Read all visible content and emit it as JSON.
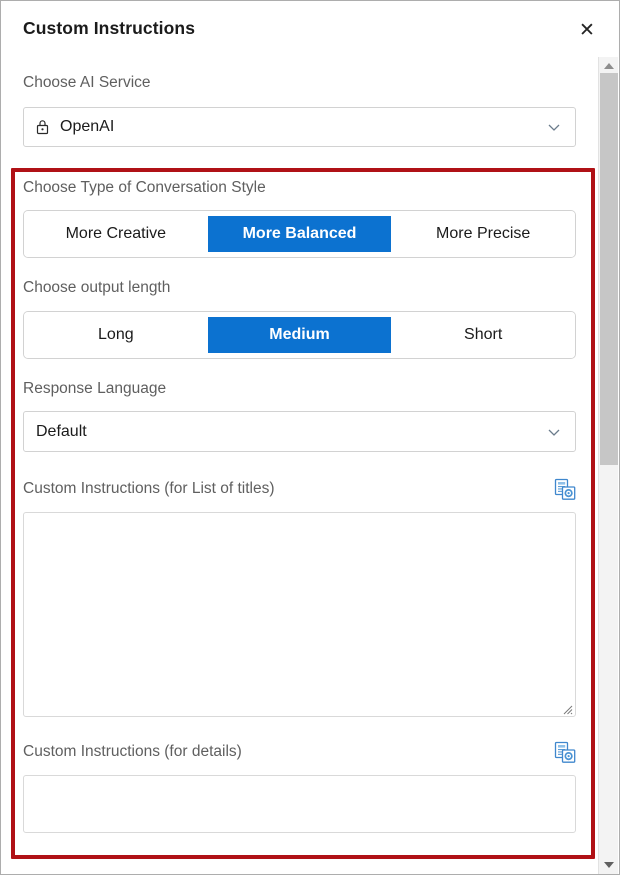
{
  "dialog": {
    "title": "Custom Instructions",
    "close_label": "✕",
    "close_icon": "close-icon"
  },
  "accent": {
    "blue": "#0c72d0",
    "annotation_red": "#b01116",
    "focus_blue": "#1f6bb0",
    "label_gray": "#5f5f5f"
  },
  "fields": {
    "ai_service": {
      "label": "Choose AI Service",
      "value": "OpenAI",
      "lock_icon": "lock-icon",
      "chevron_icon": "chevron-down-icon"
    },
    "conversation_style": {
      "label": "Choose Type of Conversation Style",
      "options": [
        "More Creative",
        "More Balanced",
        "More Precise"
      ],
      "selected": "More Balanced"
    },
    "output_length": {
      "label": "Choose output length",
      "options": [
        "Long",
        "Medium",
        "Short"
      ],
      "selected": "Medium"
    },
    "response_language": {
      "label": "Response Language",
      "value": "Default",
      "chevron_icon": "chevron-down-icon"
    },
    "custom_instructions_titles": {
      "label": "Custom Instructions (for List of titles)",
      "value": "",
      "placeholder": "",
      "action_icon": "document-settings-icon"
    },
    "custom_instructions_details": {
      "label": "Custom Instructions (for details)",
      "value": "",
      "placeholder": "",
      "action_icon": "document-settings-icon"
    }
  },
  "scrollbar": {
    "up_icon": "scroll-up-arrow-icon",
    "down_icon": "scroll-down-arrow-icon",
    "thumb_name": "scrollbar-thumb"
  },
  "annotation": {
    "name": "red-highlight-rectangle"
  }
}
